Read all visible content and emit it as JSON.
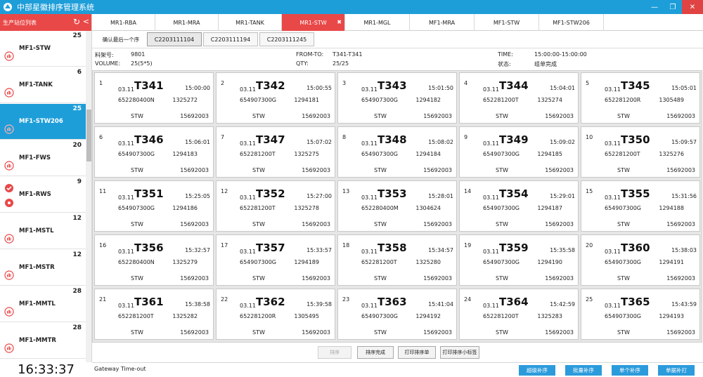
{
  "window": {
    "title": "中部星徽排序管理系统",
    "minimize": "—",
    "restore": "❐",
    "close": "✕"
  },
  "sidebar": {
    "header": "生产站位列表",
    "refresh": "↻",
    "collapse": "<",
    "items": [
      {
        "name": "MF1-STW",
        "count": "25",
        "icon": "hand"
      },
      {
        "name": "MF1-TANK",
        "count": "6",
        "icon": "hand"
      },
      {
        "name": "MF1-STW206",
        "count": "25",
        "icon": "hand",
        "active": true
      },
      {
        "name": "MF1-FWS",
        "count": "20",
        "icon": "hand"
      },
      {
        "name": "MF1-RWS",
        "count": "9",
        "icon": "check-gear"
      },
      {
        "name": "MF1-MSTL",
        "count": "12",
        "icon": "hand"
      },
      {
        "name": "MF1-MSTR",
        "count": "12",
        "icon": "hand"
      },
      {
        "name": "MF1-MMTL",
        "count": "28",
        "icon": "hand"
      },
      {
        "name": "MF1-MMTR",
        "count": "28",
        "icon": "hand"
      }
    ]
  },
  "clock": "16:33:37",
  "tabs": [
    {
      "label": "MR1-RBA",
      "closable": false
    },
    {
      "label": "MR1-MRA",
      "closable": false
    },
    {
      "label": "MR1-TANK",
      "closable": false
    },
    {
      "label": "MR1-STW",
      "closable": true,
      "active": true
    },
    {
      "label": "MR1-MGL",
      "closable": false
    },
    {
      "label": "MF1-MRA",
      "closable": false
    },
    {
      "label": "MF1-STW",
      "closable": false
    },
    {
      "label": "MF1-STW206",
      "closable": false
    }
  ],
  "close_x": "✖",
  "subbar": {
    "confirm": "确认最后一个序",
    "orders": [
      "C2203111104",
      "C2203111194",
      "C2203111245"
    ]
  },
  "info": {
    "rack_label": "料架号:",
    "rack": "9801",
    "volume_label": "VOLUME:",
    "volume": "25(5*5)",
    "fromto_label": "FROM-TO:",
    "fromto": "T341-T341",
    "qty_label": "QTY:",
    "qty": "25/25",
    "time_label": "TIME:",
    "time": "15:00:00-15:00:00",
    "state_label": "状态:",
    "state": "组单完成"
  },
  "cards": [
    {
      "idx": "1",
      "date": "03.11",
      "code": "T341",
      "time": "15:00:00",
      "pn": "652280400N",
      "serial": "1325272",
      "station": "STW",
      "num": "15692003"
    },
    {
      "idx": "2",
      "date": "03.11",
      "code": "T342",
      "time": "15:00:55",
      "pn": "654907300G",
      "serial": "1294181",
      "station": "STW",
      "num": "15692003"
    },
    {
      "idx": "3",
      "date": "03.11",
      "code": "T343",
      "time": "15:01:50",
      "pn": "654907300G",
      "serial": "1294182",
      "station": "STW",
      "num": "15692003"
    },
    {
      "idx": "4",
      "date": "03.11",
      "code": "T344",
      "time": "15:04:01",
      "pn": "652281200T",
      "serial": "1325274",
      "station": "STW",
      "num": "15692003"
    },
    {
      "idx": "5",
      "date": "03.11",
      "code": "T345",
      "time": "15:05:01",
      "pn": "652281200R",
      "serial": "1305489",
      "station": "STW",
      "num": "15692003"
    },
    {
      "idx": "6",
      "date": "03.11",
      "code": "T346",
      "time": "15:06:01",
      "pn": "654907300G",
      "serial": "1294183",
      "station": "STW",
      "num": "15692003"
    },
    {
      "idx": "7",
      "date": "03.11",
      "code": "T347",
      "time": "15:07:02",
      "pn": "652281200T",
      "serial": "1325275",
      "station": "STW",
      "num": "15692003"
    },
    {
      "idx": "8",
      "date": "03.11",
      "code": "T348",
      "time": "15:08:02",
      "pn": "654907300G",
      "serial": "1294184",
      "station": "STW",
      "num": "15692003"
    },
    {
      "idx": "9",
      "date": "03.11",
      "code": "T349",
      "time": "15:09:02",
      "pn": "654907300G",
      "serial": "1294185",
      "station": "STW",
      "num": "15692003"
    },
    {
      "idx": "10",
      "date": "03.11",
      "code": "T350",
      "time": "15:09:57",
      "pn": "652281200T",
      "serial": "1325276",
      "station": "STW",
      "num": "15692003"
    },
    {
      "idx": "11",
      "date": "03.11",
      "code": "T351",
      "time": "15:25:05",
      "pn": "654907300G",
      "serial": "1294186",
      "station": "STW",
      "num": "15692003"
    },
    {
      "idx": "12",
      "date": "03.11",
      "code": "T352",
      "time": "15:27:00",
      "pn": "652281200T",
      "serial": "1325278",
      "station": "STW",
      "num": "15692003"
    },
    {
      "idx": "13",
      "date": "03.11",
      "code": "T353",
      "time": "15:28:01",
      "pn": "652280400M",
      "serial": "1304624",
      "station": "STW",
      "num": "15692003"
    },
    {
      "idx": "14",
      "date": "03.11",
      "code": "T354",
      "time": "15:29:01",
      "pn": "654907300G",
      "serial": "1294187",
      "station": "STW",
      "num": "15692003"
    },
    {
      "idx": "15",
      "date": "03.11",
      "code": "T355",
      "time": "15:31:56",
      "pn": "654907300G",
      "serial": "1294188",
      "station": "STW",
      "num": "15692003"
    },
    {
      "idx": "16",
      "date": "03.11",
      "code": "T356",
      "time": "15:32:57",
      "pn": "652280400N",
      "serial": "1325279",
      "station": "STW",
      "num": "15692003"
    },
    {
      "idx": "17",
      "date": "03.11",
      "code": "T357",
      "time": "15:33:57",
      "pn": "654907300G",
      "serial": "1294189",
      "station": "STW",
      "num": "15692003"
    },
    {
      "idx": "18",
      "date": "03.11",
      "code": "T358",
      "time": "15:34:57",
      "pn": "652281200T",
      "serial": "1325280",
      "station": "STW",
      "num": "15692003"
    },
    {
      "idx": "19",
      "date": "03.11",
      "code": "T359",
      "time": "15:35:58",
      "pn": "654907300G",
      "serial": "1294190",
      "station": "STW",
      "num": "15692003"
    },
    {
      "idx": "20",
      "date": "03.11",
      "code": "T360",
      "time": "15:38:03",
      "pn": "654907300G",
      "serial": "1294191",
      "station": "STW",
      "num": "15692003"
    },
    {
      "idx": "21",
      "date": "03.11",
      "code": "T361",
      "time": "15:38:58",
      "pn": "652281200T",
      "serial": "1325282",
      "station": "STW",
      "num": "15692003"
    },
    {
      "idx": "22",
      "date": "03.11",
      "code": "T362",
      "time": "15:39:58",
      "pn": "652281200R",
      "serial": "1305495",
      "station": "STW",
      "num": "15692003"
    },
    {
      "idx": "23",
      "date": "03.11",
      "code": "T363",
      "time": "15:41:04",
      "pn": "654907300G",
      "serial": "1294192",
      "station": "STW",
      "num": "15692003"
    },
    {
      "idx": "24",
      "date": "03.11",
      "code": "T364",
      "time": "15:42:59",
      "pn": "652281200T",
      "serial": "1325283",
      "station": "STW",
      "num": "15692003"
    },
    {
      "idx": "25",
      "date": "03.11",
      "code": "T365",
      "time": "15:43:59",
      "pn": "654907300G",
      "serial": "1294193",
      "station": "STW",
      "num": "15692003"
    }
  ],
  "actions": {
    "sort": "排序",
    "sort_done": "排序完成",
    "print_sheet": "打印排序单",
    "print_label": "打印排序小标签"
  },
  "status": {
    "message": "Gateway Time-out",
    "super_supply": "超级补序",
    "batch_supply": "批量补序",
    "single_supply": "单个补序",
    "single_print": "单据补打"
  },
  "colors": {
    "accent": "#1e9ed9",
    "alert": "#e94848",
    "button": "#2c9bdb"
  }
}
